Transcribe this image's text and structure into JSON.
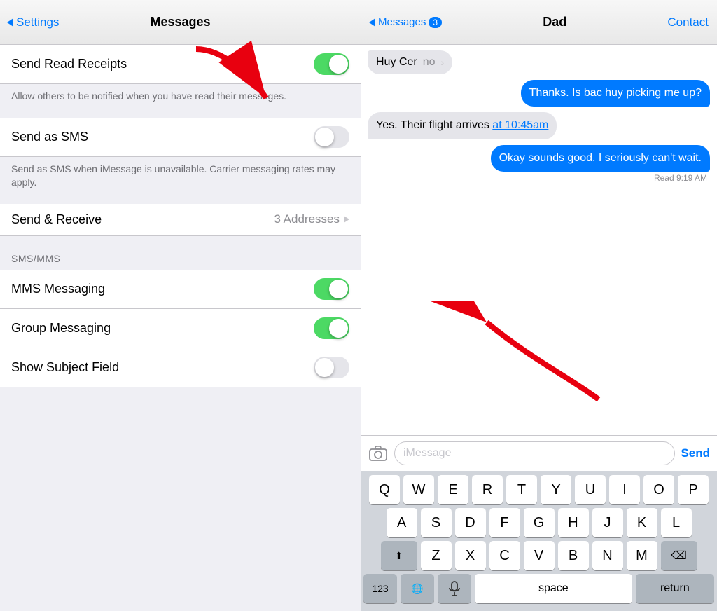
{
  "settings": {
    "back_label": "Settings",
    "title": "Messages",
    "rows": [
      {
        "id": "send-read-receipts",
        "label": "Send Read Receipts",
        "toggle": "on",
        "description": "Allow others to be notified when you have read their messages."
      },
      {
        "id": "send-as-sms",
        "label": "Send as SMS",
        "toggle": "off",
        "description": "Send as SMS when iMessage is unavailable. Carrier messaging rates may apply."
      },
      {
        "id": "send-receive",
        "label": "Send & Receive",
        "detail": "3 Addresses",
        "toggle": null
      }
    ],
    "sms_section_header": "SMS/MMS",
    "sms_rows": [
      {
        "id": "mms-messaging",
        "label": "MMS Messaging",
        "toggle": "on"
      },
      {
        "id": "group-messaging",
        "label": "Group Messaging",
        "toggle": "on"
      },
      {
        "id": "show-subject-field",
        "label": "Show Subject Field",
        "toggle": "off"
      }
    ]
  },
  "messages": {
    "back_label": "Messages",
    "back_count": "3",
    "contact_name": "Dad",
    "contact_btn": "Contact",
    "old_message": {
      "text": "Huy Cer",
      "detail": "no"
    },
    "bubbles": [
      {
        "id": "msg1",
        "type": "outgoing",
        "text": "Thanks. Is bac huy picking me up?"
      },
      {
        "id": "msg2",
        "type": "incoming",
        "text_before": "Yes. Their flight arrives ",
        "link_text": "at 10:45am",
        "text_after": ""
      },
      {
        "id": "msg3",
        "type": "outgoing",
        "text": "Okay sounds good. I seriously can't wait."
      }
    ],
    "read_status": "Read 9:19 AM",
    "input_placeholder": "iMessage",
    "send_label": "Send"
  },
  "keyboard": {
    "rows": [
      [
        "Q",
        "W",
        "E",
        "R",
        "T",
        "Y",
        "U",
        "I",
        "O",
        "P"
      ],
      [
        "A",
        "S",
        "D",
        "F",
        "G",
        "H",
        "J",
        "K",
        "L"
      ],
      [
        "Z",
        "X",
        "C",
        "V",
        "B",
        "N",
        "M"
      ]
    ],
    "shift_label": "⬆",
    "delete_label": "⌫",
    "num_label": "123",
    "globe_label": "🌐",
    "mic_label": "🎤",
    "space_label": "space",
    "return_label": "return"
  },
  "icons": {
    "chevron_left": "❮",
    "chevron_right": "❯",
    "camera": "📷"
  }
}
